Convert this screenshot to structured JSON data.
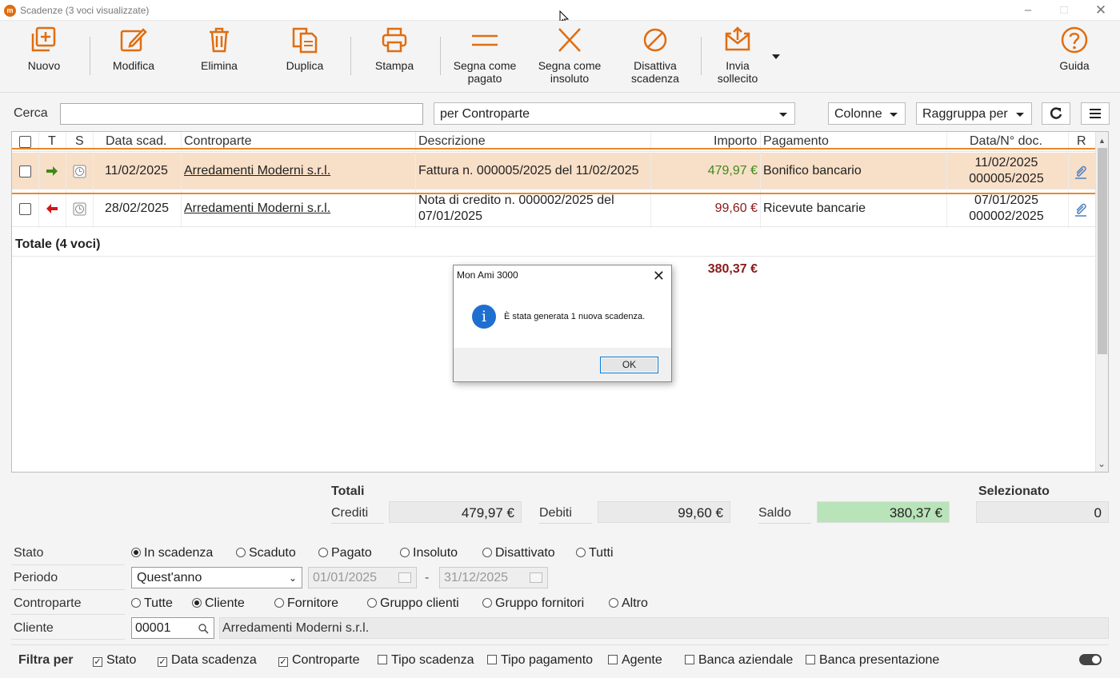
{
  "window": {
    "title": "Scadenze (3 voci visualizzate)"
  },
  "toolbar": {
    "buttons": [
      {
        "label": "Nuovo",
        "icon": "new-document-icon"
      },
      {
        "label": "Modifica",
        "icon": "pencil-icon"
      },
      {
        "label": "Elimina",
        "icon": "trash-icon"
      },
      {
        "label": "Duplica",
        "icon": "duplicate-icon"
      },
      {
        "label": "Stampa",
        "icon": "printer-icon"
      },
      {
        "label": "Segna come pagato",
        "icon": "equals-icon"
      },
      {
        "label": "Segna come insoluto",
        "icon": "x-icon"
      },
      {
        "label": "Disattiva scadenza",
        "icon": "ban-icon"
      },
      {
        "label": "Invia sollecito",
        "icon": "send-mail-icon"
      },
      {
        "label": "Guida",
        "icon": "help-icon"
      }
    ]
  },
  "search": {
    "label": "Cerca",
    "value": "",
    "filter_mode": "per Controparte",
    "columns_label": "Colonne",
    "group_label": "Raggruppa per"
  },
  "grid": {
    "headers": [
      "T",
      "S",
      "Data scad.",
      "Controparte",
      "Descrizione",
      "Importo",
      "Pagamento",
      "Data/N° doc.",
      "R"
    ],
    "rows": [
      {
        "date": "11/02/2025",
        "counterpart": "Arredamenti Moderni s.r.l.",
        "description": "Fattura n. 000005/2025 del 11/02/2025",
        "amount": "479,97 €",
        "payment": "Bonifico bancario",
        "doc_date": "11/02/2025",
        "doc_no": "000005/2025",
        "direction": "incoming"
      },
      {
        "date": "28/02/2025",
        "counterpart": "Arredamenti Moderni s.r.l.",
        "description": "Nota di credito n. 000002/2025 del 07/01/2025",
        "amount": "99,60 €",
        "payment": "Ricevute bancarie",
        "doc_date": "07/01/2025",
        "doc_no": "000002/2025",
        "direction": "outgoing"
      }
    ],
    "total_label": "Totale (4 voci)",
    "total_amount": "380,37 €"
  },
  "dialog": {
    "title": "Mon Ami 3000",
    "message": "È stata generata 1 nuova scadenza.",
    "ok_label": "OK"
  },
  "totals": {
    "title": "Totali",
    "crediti_label": "Crediti",
    "crediti": "479,97 €",
    "debiti_label": "Debiti",
    "debiti": "99,60 €",
    "saldo_label": "Saldo",
    "saldo": "380,37 €",
    "selected_label": "Selezionato",
    "selected": "0"
  },
  "filters": {
    "stato_label": "Stato",
    "stato_options": [
      "In scadenza",
      "Scaduto",
      "Pagato",
      "Insoluto",
      "Disattivato",
      "Tutti"
    ],
    "periodo_label": "Periodo",
    "periodo_value": "Quest'anno",
    "date_from": "01/01/2025",
    "date_sep": "-",
    "date_to": "31/12/2025",
    "controparte_label": "Controparte",
    "controparte_options": [
      "Tutte",
      "Cliente",
      "Fornitore",
      "Gruppo clienti",
      "Gruppo fornitori",
      "Altro"
    ],
    "cliente_label": "Cliente",
    "cliente_code": "00001",
    "cliente_name": "Arredamenti Moderni s.r.l."
  },
  "filter_by": {
    "label": "Filtra per",
    "options": [
      "Stato",
      "Data scadenza",
      "Controparte",
      "Tipo scadenza",
      "Tipo pagamento",
      "Agente",
      "Banca aziendale",
      "Banca presentazione"
    ]
  },
  "colors": {
    "accent": "#e06d10",
    "credit": "#3f8a1c",
    "debit": "#8b1a1a",
    "selected_row": "#f8dfc8",
    "saldo_bg": "#b9e3b9"
  }
}
